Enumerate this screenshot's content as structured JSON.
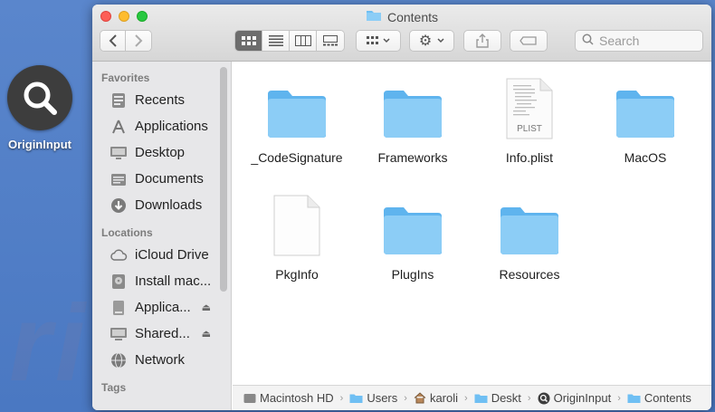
{
  "desktop": {
    "app_label": "OriginInput"
  },
  "window": {
    "title": "Contents",
    "search_placeholder": "Search"
  },
  "sidebar": {
    "favorites_heading": "Favorites",
    "favorites": [
      {
        "label": "Recents",
        "icon": "clock-icon"
      },
      {
        "label": "Applications",
        "icon": "applications-icon"
      },
      {
        "label": "Desktop",
        "icon": "desktop-icon"
      },
      {
        "label": "Documents",
        "icon": "document-icon"
      },
      {
        "label": "Downloads",
        "icon": "download-icon"
      }
    ],
    "locations_heading": "Locations",
    "locations": [
      {
        "label": "iCloud Drive",
        "icon": "cloud-icon"
      },
      {
        "label": "Install mac...",
        "icon": "disk-icon"
      },
      {
        "label": "Applica...",
        "icon": "drive-icon",
        "eject": true
      },
      {
        "label": "Shared...",
        "icon": "display-icon",
        "eject": true
      },
      {
        "label": "Network",
        "icon": "globe-icon"
      }
    ],
    "tags_heading": "Tags"
  },
  "files": [
    {
      "name": "_CodeSignature",
      "type": "folder"
    },
    {
      "name": "Frameworks",
      "type": "folder"
    },
    {
      "name": "Info.plist",
      "type": "plist",
      "badge": "PLIST"
    },
    {
      "name": "MacOS",
      "type": "folder"
    },
    {
      "name": "PkgInfo",
      "type": "file"
    },
    {
      "name": "PlugIns",
      "type": "folder"
    },
    {
      "name": "Resources",
      "type": "folder"
    }
  ],
  "pathbar": [
    {
      "label": "Macintosh HD",
      "icon": "hd-icon"
    },
    {
      "label": "Users",
      "icon": "folder-icon"
    },
    {
      "label": "karoli",
      "icon": "home-icon"
    },
    {
      "label": "Deskt",
      "icon": "folder-icon"
    },
    {
      "label": "OriginInput",
      "icon": "app-icon"
    },
    {
      "label": "Contents",
      "icon": "folder-icon"
    }
  ],
  "colors": {
    "folder": "#6fbff3",
    "accent": "#4f7dc6"
  }
}
